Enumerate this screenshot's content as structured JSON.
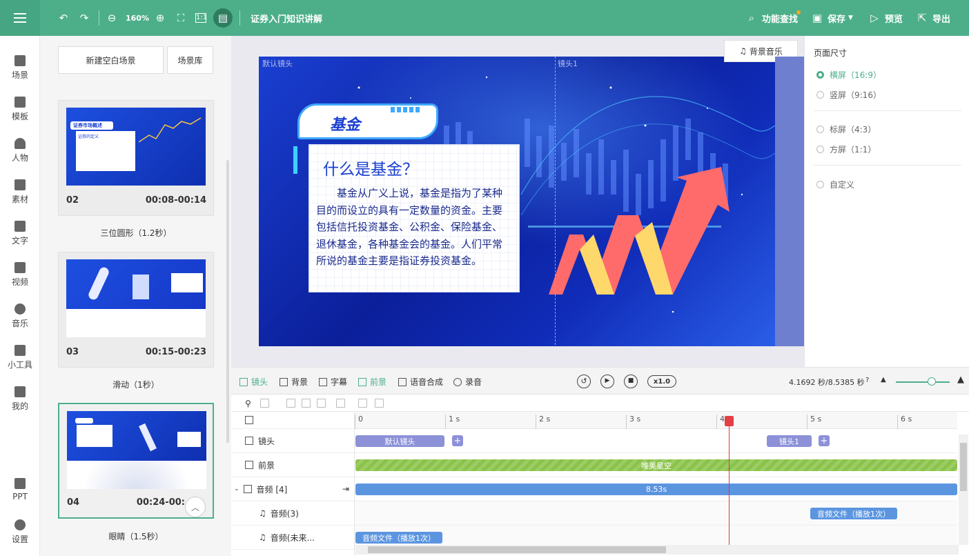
{
  "topbar": {
    "zoom": "160%",
    "project_title": "证券入门知识讲解",
    "feature_search": "功能查找",
    "save": "保存",
    "preview": "预览",
    "export": "导出"
  },
  "sidenav": [
    {
      "label": "场景",
      "icon": "scene-icon"
    },
    {
      "label": "模板",
      "icon": "template-icon"
    },
    {
      "label": "人物",
      "icon": "person-icon"
    },
    {
      "label": "素材",
      "icon": "material-icon"
    },
    {
      "label": "文字",
      "icon": "text-icon"
    },
    {
      "label": "视频",
      "icon": "video-icon"
    },
    {
      "label": "音乐",
      "icon": "music-icon"
    },
    {
      "label": "小工具",
      "icon": "toolbox-icon"
    },
    {
      "label": "我的",
      "icon": "my-icon"
    },
    {
      "label": "PPT",
      "icon": "ppt-icon"
    },
    {
      "label": "设置",
      "icon": "settings-icon"
    }
  ],
  "scenes": {
    "new_blank": "新建空白场景",
    "library": "场景库",
    "cards": [
      {
        "num": "02",
        "time": "00:08-00:14",
        "transition": "三位圆形（1.2秒）"
      },
      {
        "num": "03",
        "time": "00:15-00:23",
        "transition": "滑动（1秒）"
      },
      {
        "num": "04",
        "time": "00:24-00:",
        "transition": "眼睛（1.5秒）"
      }
    ],
    "thumb02": {
      "tag": "证券市场概述",
      "subtitle": "证券的定义"
    }
  },
  "stage": {
    "cam_default": "默认镜头",
    "cam1": "镜头1",
    "bgm": "背景音乐",
    "badge": "基金",
    "heading": "什么是基金？",
    "body": "　　基金从广义上说，基金是指为了某种目的而设立的具有一定数量的资金。主要包括信托投资基金、公积金、保险基金、退休基金，各种基金会的基金。人们平常所说的基金主要是指证券投资基金。"
  },
  "page_size": {
    "title": "页面尺寸",
    "options": [
      {
        "label": "横屏（16:9）",
        "selected": true
      },
      {
        "label": "竖屏（9:16）",
        "selected": false
      },
      {
        "label": "标屏（4:3）",
        "selected": false
      },
      {
        "label": "方屏（1:1）",
        "selected": false
      },
      {
        "label": "自定义",
        "selected": false
      }
    ]
  },
  "timeline_tabs": {
    "camera": "镜头",
    "background": "背景",
    "subtitle": "字幕",
    "foreground": "前景",
    "tts": "语音合成",
    "record": "录音"
  },
  "playback": {
    "speed": "x1.0",
    "time": "4.1692 秒/8.5385 秒"
  },
  "ruler": [
    "0",
    "1 s",
    "2 s",
    "3 s",
    "4 s",
    "5 s",
    "6 s"
  ],
  "tracks": {
    "camera": "镜头",
    "foreground": "前景",
    "audio_group": "音频 [4]",
    "audio3": "音频(3)",
    "audio_unnamed": "音频(未来...",
    "clip_cam_default": "默认镜头",
    "clip_cam1": "镜头1",
    "clip_fg": "唯美星空",
    "clip_audio_total": "8.53s",
    "clip_audio3": "音频文件（播放1次）",
    "clip_audio_unnamed": "音频文件（播放1次）"
  },
  "colors": {
    "brand": "#4caf8a",
    "stage_blue": "#1432c0",
    "clip_camera": "#8c91d8",
    "clip_foreground": "#8bc34a",
    "clip_audio": "#5b95e0",
    "playhead": "#e53e46"
  }
}
